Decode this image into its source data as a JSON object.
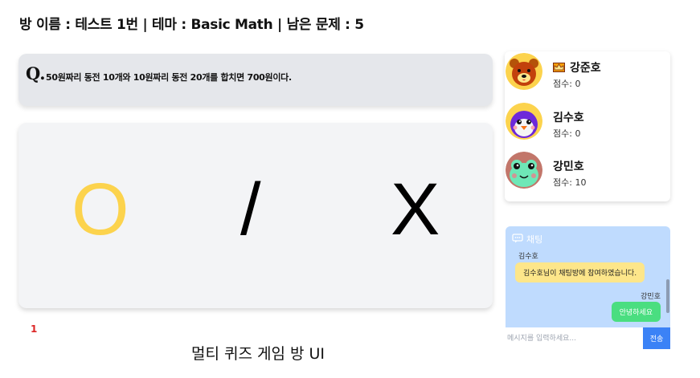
{
  "header": {
    "text": "방 이름 : 테스트 1번 | 테마 : Basic Math | 남은 문제 : 5"
  },
  "question": {
    "mark": "Q.",
    "text": "50원짜리 동전 10개와 10원짜리 동전 20개를 합치면 700원이다."
  },
  "answers": {
    "o": "O",
    "separator": "/",
    "x": "X"
  },
  "counter": "1",
  "caption": "멀티 퀴즈 게임 방 UI",
  "players": [
    {
      "name": "강준호",
      "score": "점수: 0",
      "leader": true,
      "avatar": "bear-avatar"
    },
    {
      "name": "김수호",
      "score": "점수: 0",
      "leader": false,
      "avatar": "penguin-avatar"
    },
    {
      "name": "강민호",
      "score": "점수: 10",
      "leader": false,
      "avatar": "frog-avatar"
    }
  ],
  "chat": {
    "title": "채팅",
    "messages": [
      {
        "sender": "김수호",
        "text": "김수호님이 채팅방에 참여하였습니다.",
        "side": "left"
      },
      {
        "sender": "강민호",
        "text": "안녕하세요",
        "side": "right"
      }
    ],
    "input_placeholder": "메시지를 입력하세요...",
    "send_label": "전송"
  },
  "colors": {
    "o_answer": "#fcd34d",
    "counter": "#dc2626",
    "chat_bg": "#bfdbfe",
    "system_bubble": "#fde68a",
    "user_bubble": "#4ade80",
    "send_button": "#3b82f6"
  }
}
